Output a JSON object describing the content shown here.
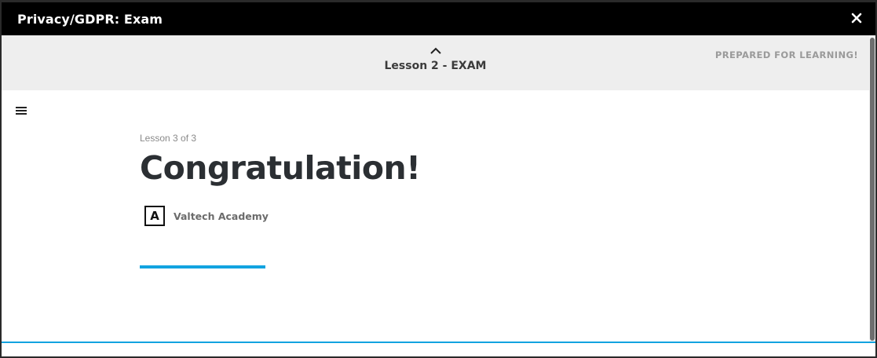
{
  "window": {
    "title": "Privacy/GDPR: Exam",
    "close_icon": "close-icon"
  },
  "lesson_nav": {
    "label": "Lesson 2 - EXAM",
    "icon": "chevron-up-icon",
    "tagline": "PREPARED FOR LEARNING!"
  },
  "menu": {
    "icon": "hamburger-menu-icon"
  },
  "lesson": {
    "count": "Lesson 3 of 3",
    "title": "Congratulation!",
    "author_initial": "A",
    "author_name": "Valtech Academy"
  },
  "colors": {
    "accent": "#12a3e0",
    "titlebar": "#000000",
    "lessonbar": "#eeeeee",
    "heading": "#2b2f33"
  }
}
